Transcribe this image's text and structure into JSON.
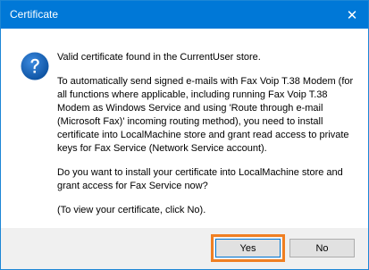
{
  "window": {
    "title": "Certificate",
    "close_glyph": "✕"
  },
  "icon": "question-icon",
  "message": {
    "line1": "Valid certificate found in the CurrentUser store.",
    "paragraph2": "To automatically send signed e-mails with Fax Voip T.38 Modem (for all functions where applicable, including running Fax Voip T.38 Modem as Windows Service and using 'Route through e-mail (Microsoft Fax)' incoming routing method), you need to install certificate into LocalMachine store and grant read access to private keys for Fax Service (Network Service account).",
    "paragraph3": "Do you want to install your certificate into LocalMachine store and grant access for Fax Service now?",
    "paragraph4": "(To view your certificate, click No)."
  },
  "buttons": {
    "yes_label": "Yes",
    "no_label": "No"
  },
  "colors": {
    "titlebar": "#0078d7",
    "highlight": "#f07f22",
    "footer": "#f0f0f0"
  }
}
